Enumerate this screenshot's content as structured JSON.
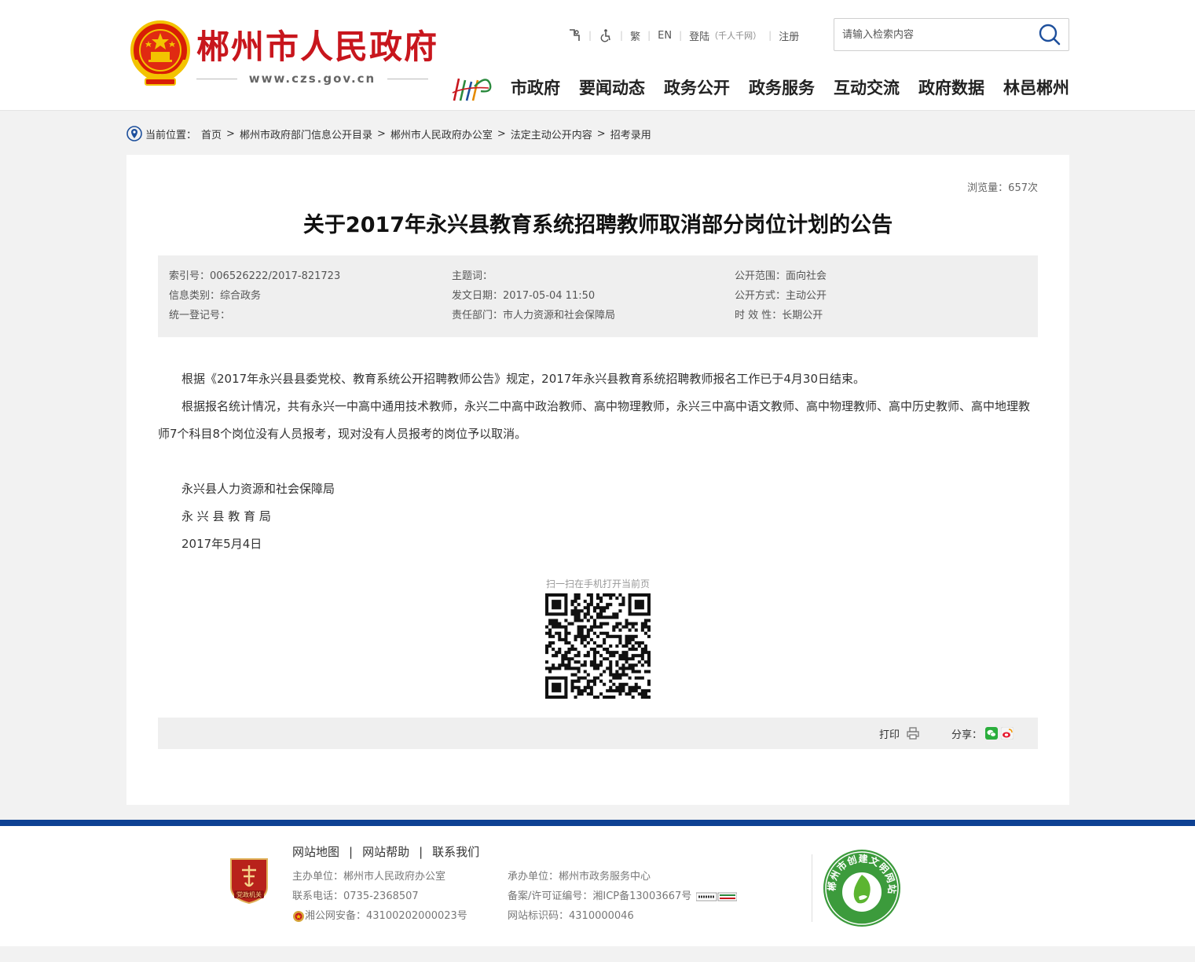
{
  "header": {
    "site_title": "郴州市人民政府",
    "site_url": "www.czs.gov.cn",
    "toolbar": {
      "traditional": "繁",
      "english": "EN",
      "login": "登陆",
      "login_note": "（千人千网）",
      "register": "注册"
    },
    "search": {
      "placeholder": "请输入检索内容"
    },
    "nav": [
      "市政府",
      "要闻动态",
      "政务公开",
      "政务服务",
      "互动交流",
      "政府数据",
      "林邑郴州"
    ]
  },
  "breadcrumb": {
    "label": "当前位置：",
    "items": [
      "首页",
      "郴州市政府部门信息公开目录",
      "郴州市人民政府办公室",
      "法定主动公开内容",
      "招考录用"
    ],
    "separator": ">"
  },
  "article": {
    "views": "浏览量：657次",
    "title": "关于2017年永兴县教育系统招聘教师取消部分岗位计划的公告",
    "meta": {
      "index_no": "索引号：006526222/2017-821723",
      "topic": "主题词：",
      "scope": "公开范围：面向社会",
      "category": "信息类别：综合政务",
      "date": "发文日期：2017-05-04 11:50",
      "method": "公开方式：主动公开",
      "reg_no": "统一登记号：",
      "dept": "责任部门：市人力资源和社会保障局",
      "validity": "时 效 性：长期公开"
    },
    "paragraphs": [
      "根据《2017年永兴县县委党校、教育系统公开招聘教师公告》规定，2017年永兴县教育系统招聘教师报名工作已于4月30日结束。",
      "根据报名统计情况，共有永兴一中高中通用技术教师，永兴二中高中政治教师、高中物理教师，永兴三中高中语文教师、高中物理教师、高中历史教师、高中地理教师7个科目8个岗位没有人员报考，现对没有人员报考的岗位予以取消。"
    ],
    "signature": [
      "永兴县人力资源和社会保障局",
      "永 兴 县 教 育 局",
      "2017年5月4日"
    ],
    "qr_label": "扫一扫在手机打开当前页",
    "print_label": "打印",
    "share_label": "分享："
  },
  "footer": {
    "links": [
      "网站地图",
      "网站帮助",
      "联系我们"
    ],
    "host": "主办单位：郴州市人民政府办公室",
    "phone": "联系电话：0735-2368507",
    "police": "湘公网安备：43100202000023号",
    "operator": "承办单位：郴州市政务服务中心",
    "icp": "备案/许可证编号：湘ICP备13003667号",
    "site_code": "网站标识码：4310000046",
    "badge_text": "党政机关",
    "civ_text": "郴州市创建文明网站"
  },
  "colors": {
    "brand_red": "#c8161d",
    "footer_blue": "#0e4193",
    "meta_bg": "#efefef"
  }
}
